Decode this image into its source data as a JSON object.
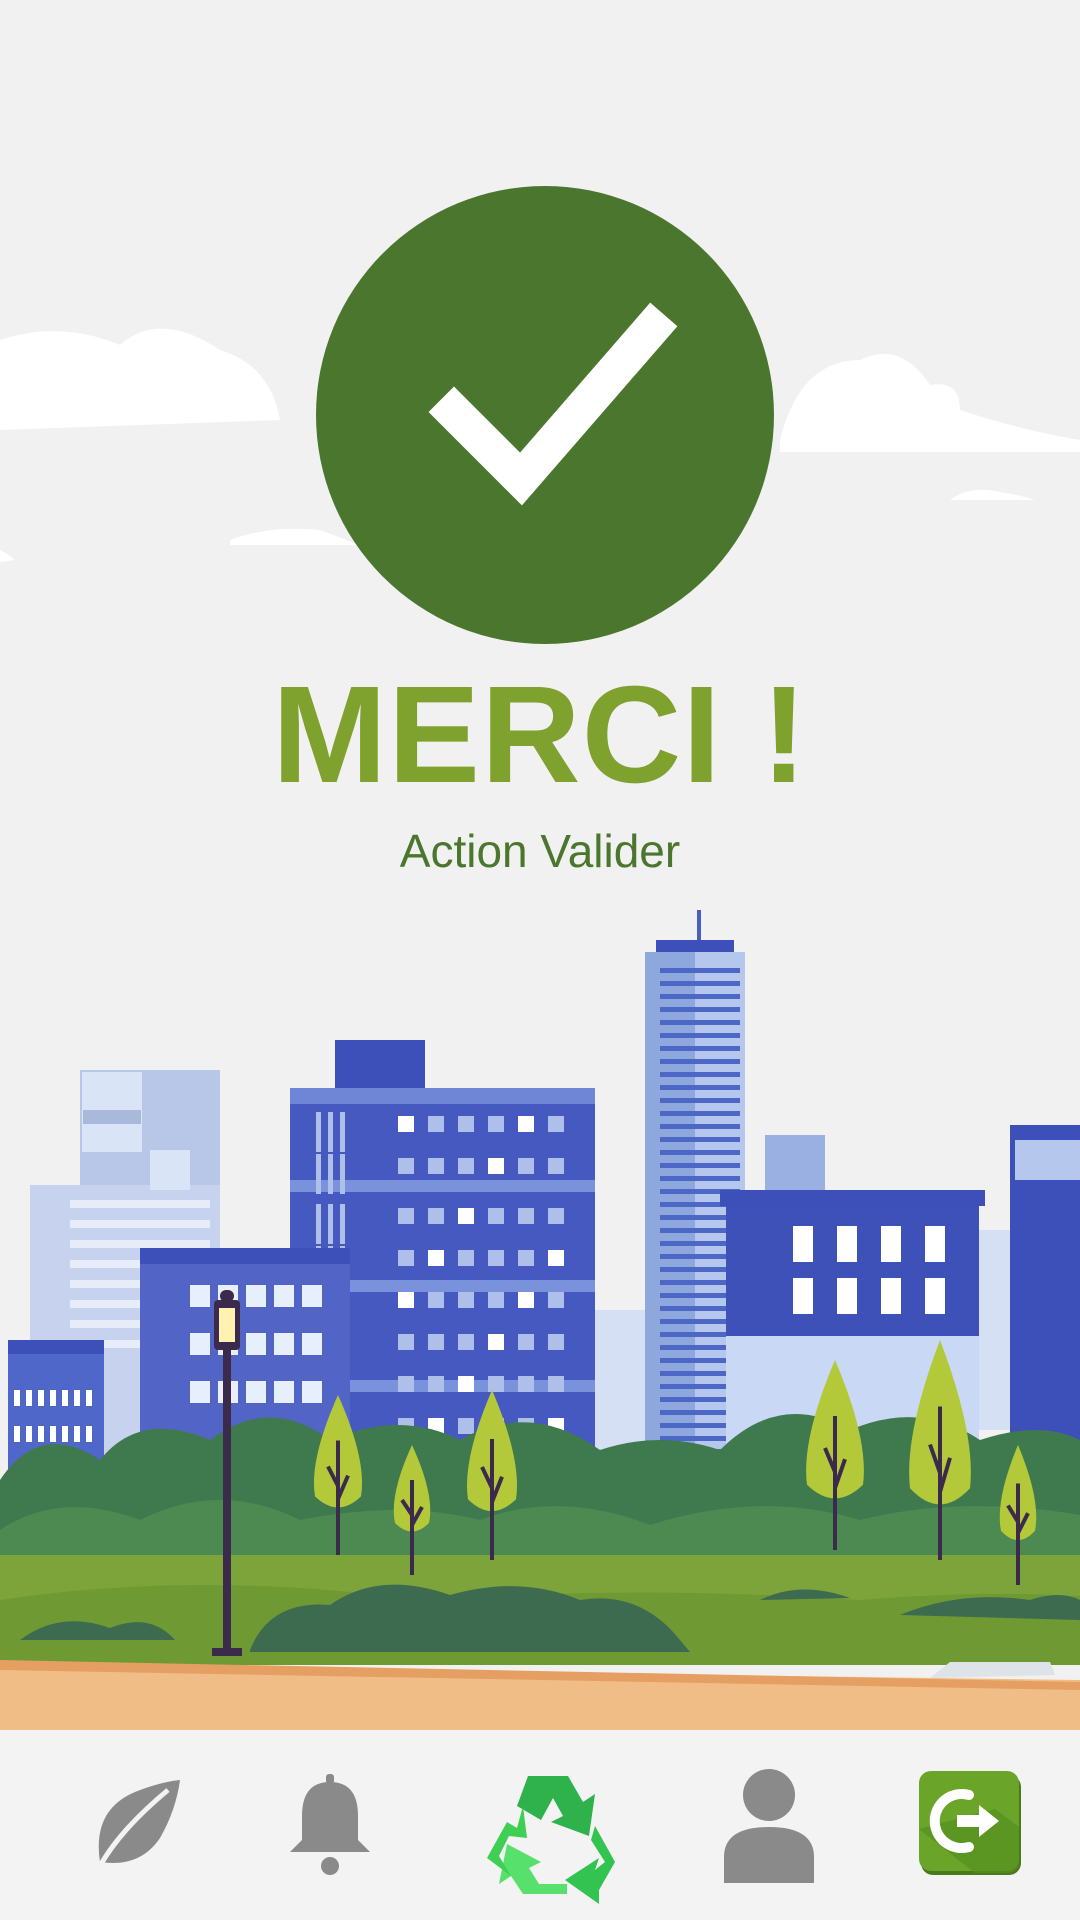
{
  "confirmation": {
    "title": "MERCI !",
    "subtitle": "Action Valider"
  },
  "bottom_nav": {
    "items": [
      {
        "icon": "leaf-icon",
        "active": false
      },
      {
        "icon": "bell-icon",
        "active": false
      },
      {
        "icon": "recycle-icon",
        "active": true
      },
      {
        "icon": "user-icon",
        "active": false
      },
      {
        "icon": "logout-icon",
        "active": false
      }
    ]
  },
  "colors": {
    "background": "#f2f1f1",
    "badge_green": "#4a772d",
    "title_green": "#7fa12e",
    "subtitle_green": "#4a772d",
    "nav_icon_gray": "#8a8a8a",
    "recycle_green": "#3fcf55",
    "logout_green": "#5f9a22"
  }
}
